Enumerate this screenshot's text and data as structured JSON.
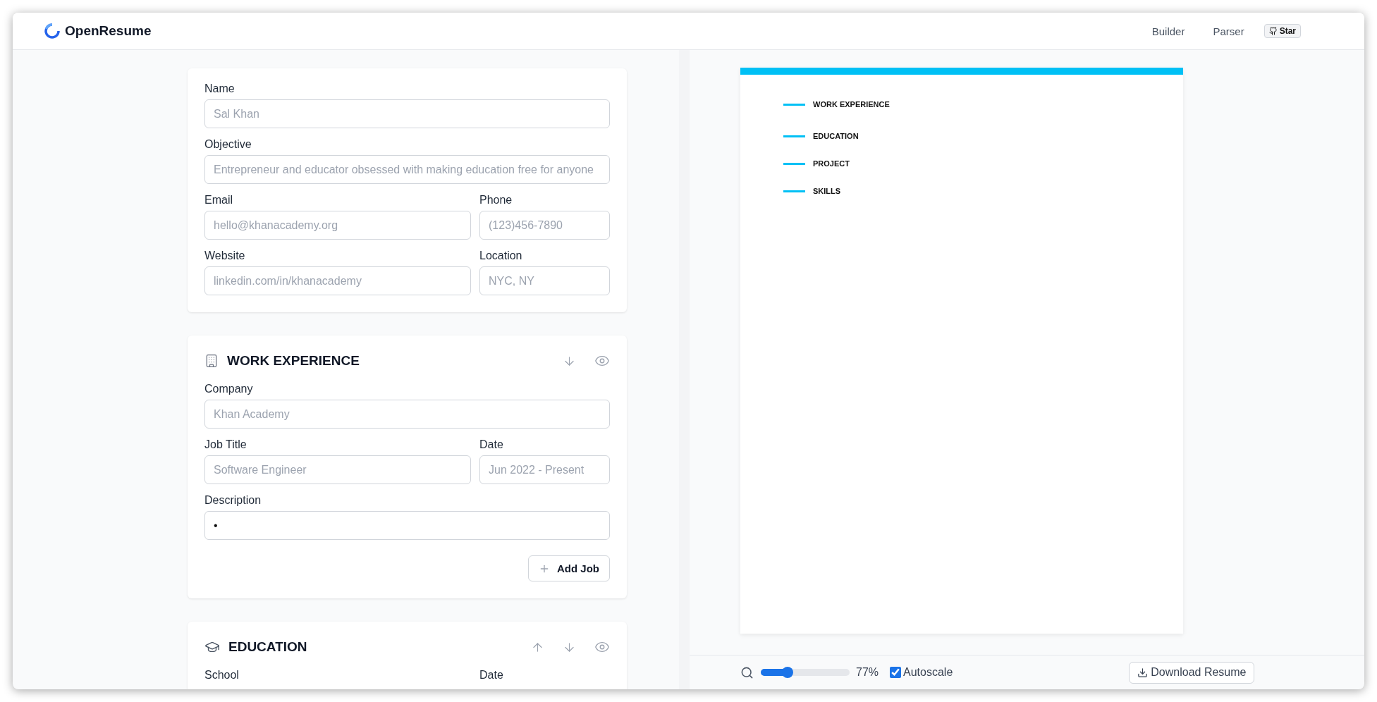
{
  "header": {
    "brand": "OpenResume",
    "nav": [
      {
        "label": "Builder"
      },
      {
        "label": "Parser"
      }
    ],
    "star_button": "Star"
  },
  "profile": {
    "rows": [
      [
        {
          "label": "Name",
          "placeholder": "Sal Khan"
        }
      ],
      [
        {
          "label": "Objective",
          "placeholder": "Entrepreneur and educator obsessed with making education free for anyone"
        }
      ],
      [
        {
          "label": "Email",
          "placeholder": "hello@khanacademy.org"
        },
        {
          "label": "Phone",
          "placeholder": "(123)456-7890"
        }
      ],
      [
        {
          "label": "Website",
          "placeholder": "linkedin.com/in/khanacademy"
        },
        {
          "label": "Location",
          "placeholder": "NYC, NY"
        }
      ]
    ]
  },
  "work_experience": {
    "title": "WORK EXPERIENCE",
    "controls": [
      {
        "kind": "down"
      },
      {
        "kind": "eye"
      }
    ],
    "rows": [
      [
        {
          "label": "Company",
          "placeholder": "Khan Academy",
          "kind": "input"
        }
      ],
      [
        {
          "label": "Job Title",
          "placeholder": "Software Engineer",
          "kind": "input"
        },
        {
          "label": "Date",
          "placeholder": "Jun 2022 - Present",
          "kind": "input"
        }
      ],
      [
        {
          "label": "Description",
          "value": "•",
          "kind": "bullets"
        }
      ]
    ],
    "add_button": "Add Job"
  },
  "education": {
    "title": "EDUCATION",
    "controls": [
      {
        "kind": "up"
      },
      {
        "kind": "down"
      },
      {
        "kind": "eye"
      }
    ],
    "labels": [
      "School",
      "Date"
    ]
  },
  "preview": {
    "sections": [
      "WORK EXPERIENCE",
      "EDUCATION",
      "PROJECT",
      "SKILLS"
    ]
  },
  "toolbar": {
    "zoom": {
      "level": 0.3,
      "reading": "77%"
    },
    "autoscale": {
      "label": "Autoscale",
      "checked": true
    },
    "download_button": "Download Resume"
  }
}
